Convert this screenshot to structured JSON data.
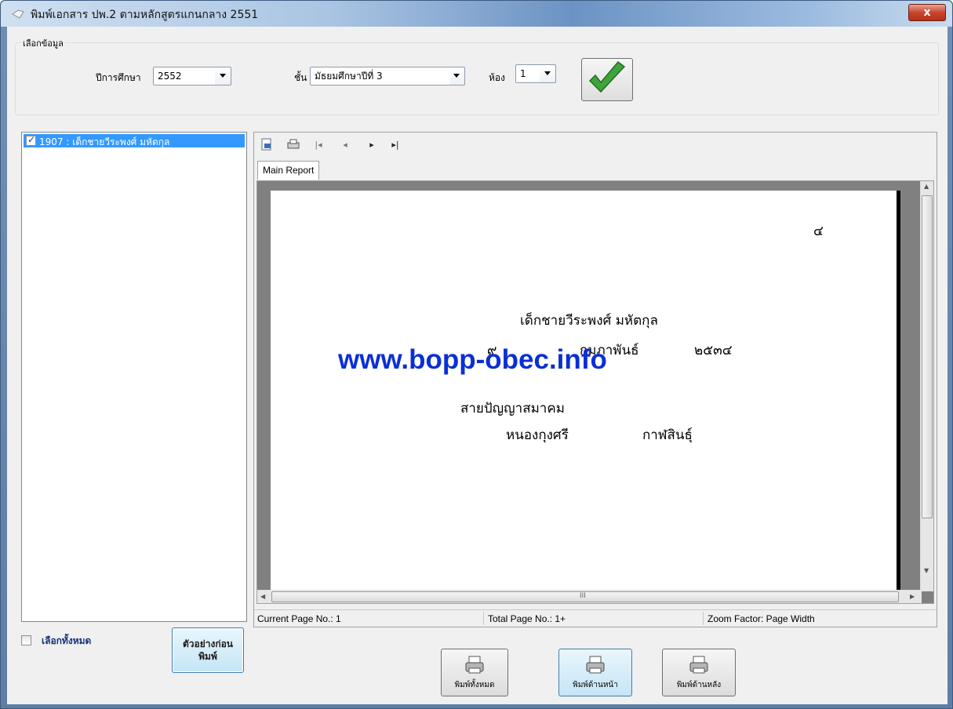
{
  "window": {
    "title": "พิมพ์เอกสาร ปพ.2 ตามหลักสูตรแกนกลาง 2551",
    "close_label": "x"
  },
  "filter": {
    "group_label": "เลือกข้อมูล",
    "year_label": "ปีการศึกษา",
    "year_value": "2552",
    "grade_label": "ชั้น",
    "grade_value": "มัธยมศึกษาปีที่ 3",
    "room_label": "ห้อง",
    "room_value": "1"
  },
  "students": [
    {
      "label": "1907 : เด็กชายวีระพงศ์ มหัตกุล",
      "checked": true
    }
  ],
  "select_all_label": "เลือกทั้งหมด",
  "preview_button_label": "ตัวอย่างก่อน\nพิมพ์",
  "viewer": {
    "tab_label": "Main Report",
    "status": {
      "current_page": "Current Page No.: 1",
      "total_page": "Total Page No.: 1+",
      "zoom": "Zoom Factor: Page Width"
    }
  },
  "report": {
    "page_number": "๔",
    "student_name": "เด็กชายวีระพงศ์  มหัตกุล",
    "birth_day": "๙",
    "birth_month": "กุมภาพันธ์",
    "birth_year": "๒๕๓๔",
    "school": "สายปัญญาสมาคม",
    "district": "หนองกุงศรี",
    "province": "กาฬสินธุ์",
    "watermark": "www.bopp-obec.info"
  },
  "print_buttons": {
    "all": "พิมพ์ทั้งหมด",
    "front": "พิมพ์ด้านหน้า",
    "back": "พิมพ์ด้านหลัง"
  },
  "scrollbar_mark": "III"
}
